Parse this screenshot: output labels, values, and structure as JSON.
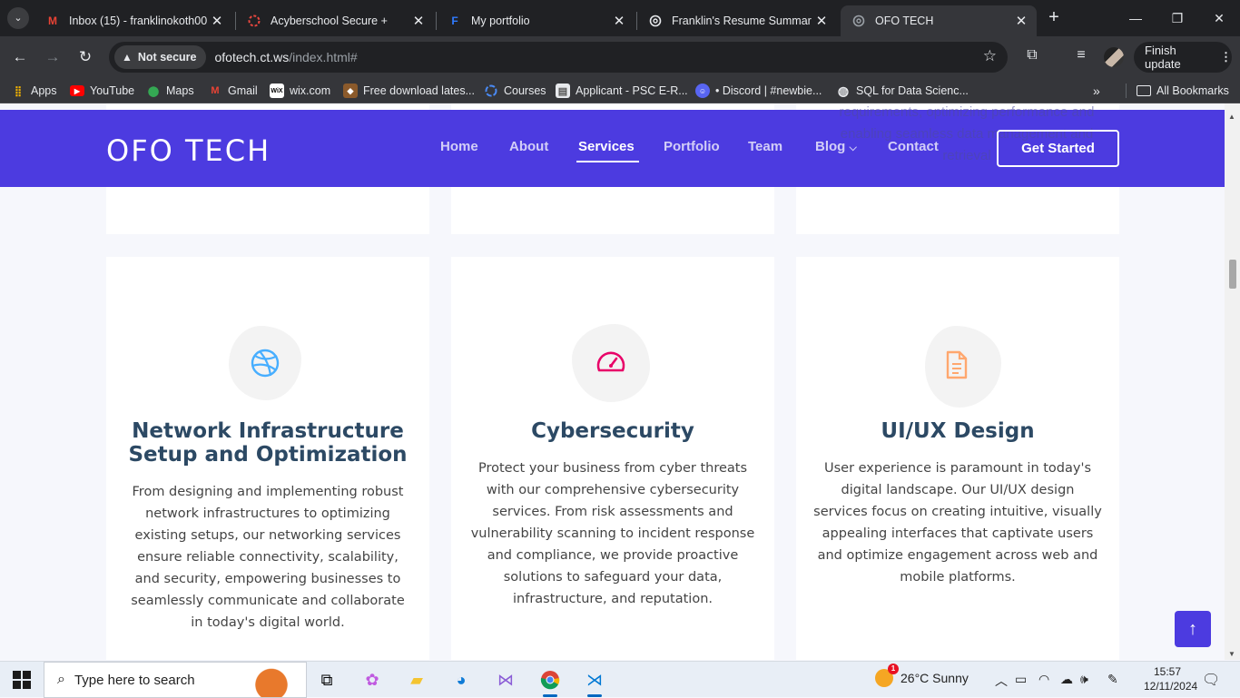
{
  "browser": {
    "tabs": [
      {
        "title": "Inbox (15) - franklinokoth00",
        "icon": "gmail-icon",
        "active": false
      },
      {
        "title": "Acyberschool Secure +",
        "icon": "loading-ring-icon",
        "active": false
      },
      {
        "title": "My portfolio",
        "icon": "framer-icon",
        "active": false
      },
      {
        "title": "Franklin's Resume Summary",
        "icon": "chatgpt-icon",
        "active": false
      },
      {
        "title": "OFO TECH",
        "icon": "chatgpt-icon",
        "active": true
      }
    ],
    "security_label": "Not secure",
    "url_host": "ofotech.ct.ws",
    "url_path": "/index.html#",
    "finish_update_label": "Finish update",
    "bookmarks": [
      {
        "label": "Apps",
        "icon": "apps-grid-icon"
      },
      {
        "label": "YouTube",
        "icon": "youtube-icon"
      },
      {
        "label": "Maps",
        "icon": "maps-pin-icon"
      },
      {
        "label": "Gmail",
        "icon": "gmail-icon"
      },
      {
        "label": "wix.com",
        "icon": "wix-icon"
      },
      {
        "label": "Free download lates...",
        "icon": "site-icon"
      },
      {
        "label": "Courses",
        "icon": "loading-ring-icon"
      },
      {
        "label": "Applicant - PSC E-R...",
        "icon": "document-icon"
      },
      {
        "label": "• Discord | #newbie...",
        "icon": "discord-icon"
      },
      {
        "label": "SQL for Data Scienc...",
        "icon": "globe-icon"
      }
    ],
    "all_bookmarks_label": "All Bookmarks"
  },
  "site": {
    "logo": "OFO TECH",
    "nav": [
      {
        "label": "Home",
        "active": false
      },
      {
        "label": "About",
        "active": false
      },
      {
        "label": "Services",
        "active": true
      },
      {
        "label": "Portfolio",
        "active": false
      },
      {
        "label": "Team",
        "active": false
      },
      {
        "label": "Blog",
        "active": false,
        "has_dropdown": true
      },
      {
        "label": "Contact",
        "active": false
      }
    ],
    "cta": "Get Started",
    "bleed_text": "requirements, optimizing performance and enabling seamless data management and retrieval",
    "services": [
      {
        "icon": "dribbble-ball-icon",
        "icon_color": "#47aeff",
        "title": "Network Infrastructure Setup and Optimization",
        "text": "From designing and implementing robust network infrastructures to optimizing existing setups, our networking services ensure reliable connectivity, scalability, and security, empowering businesses to seamlessly communicate and collaborate in today's digital world."
      },
      {
        "icon": "speedometer-icon",
        "icon_color": "#e80368",
        "title": "Cybersecurity",
        "text": "Protect your business from cyber threats with our comprehensive cybersecurity services. From risk assessments and vulnerability scanning to incident response and compliance, we provide proactive solutions to safeguard your data, infrastructure, and reputation."
      },
      {
        "icon": "file-text-icon",
        "icon_color": "#ffa76e",
        "title": "UI/UX Design",
        "text": "User experience is paramount in today's digital landscape. Our UI/UX design services focus on creating intuitive, visually appealing interfaces that captivate users and optimize engagement across web and mobile platforms."
      }
    ],
    "accent": "#4c3be0"
  },
  "taskbar": {
    "search_placeholder": "Type here to search",
    "weather": "26°C  Sunny",
    "weather_badge": "1",
    "time": "15:57",
    "date": "12/11/2024"
  }
}
